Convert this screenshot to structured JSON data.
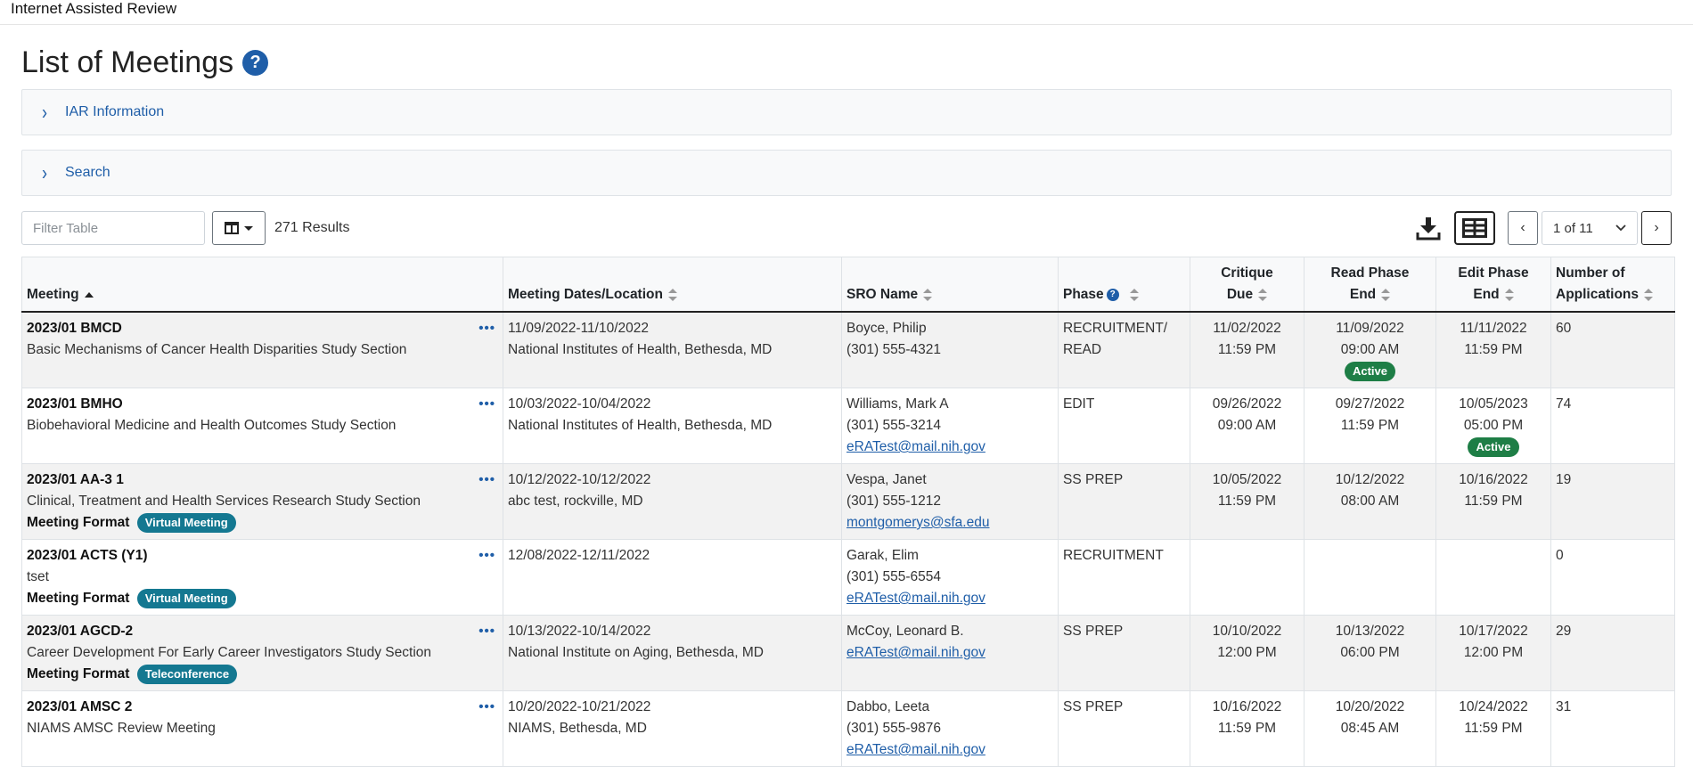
{
  "app": {
    "title": "Internet Assisted Review"
  },
  "page": {
    "title": "List of Meetings"
  },
  "accordions": {
    "iar_info": "IAR Information",
    "search": "Search"
  },
  "toolbar": {
    "filter_placeholder": "Filter Table",
    "results": "271 Results",
    "pagination": "1 of 11"
  },
  "table": {
    "headers": {
      "meeting": "Meeting",
      "dates": "Meeting Dates/Location",
      "sro": "SRO Name",
      "phase": "Phase",
      "critique_1": "Critique",
      "critique_2": "Due",
      "read_1": "Read Phase",
      "read_2": "End",
      "edit_1": "Edit Phase",
      "edit_2": "End",
      "apps_1": "Number of",
      "apps_2": "Applications"
    },
    "format_label": "Meeting Format",
    "rows": [
      {
        "code": "2023/01 BMCD",
        "name": "Basic Mechanisms of Cancer Health Disparities Study Section",
        "format": "",
        "dates": "11/09/2022-11/10/2022",
        "location": "National Institutes of Health, Bethesda, MD",
        "sro_name": "Boyce, Philip",
        "sro_phone": "(301) 555-4321",
        "sro_email": "",
        "phase": "RECRUITMENT/ READ",
        "critique_date": "11/02/2022",
        "critique_time": "11:59 PM",
        "read_date": "11/09/2022",
        "read_time": "09:00 AM",
        "read_badge": "Active",
        "edit_date": "11/11/2022",
        "edit_time": "11:59 PM",
        "edit_badge": "",
        "apps": "60"
      },
      {
        "code": "2023/01 BMHO",
        "name": "Biobehavioral Medicine and Health Outcomes Study Section",
        "format": "",
        "dates": "10/03/2022-10/04/2022",
        "location": "National Institutes of Health, Bethesda, MD",
        "sro_name": "Williams, Mark A",
        "sro_phone": "(301) 555-3214",
        "sro_email": "eRATest@mail.nih.gov",
        "phase": "EDIT",
        "critique_date": "09/26/2022",
        "critique_time": "09:00 AM",
        "read_date": "09/27/2022",
        "read_time": "11:59 PM",
        "read_badge": "",
        "edit_date": "10/05/2023",
        "edit_time": "05:00 PM",
        "edit_badge": "Active",
        "apps": "74"
      },
      {
        "code": "2023/01 AA-3 1",
        "name": "Clinical, Treatment and Health Services Research Study Section",
        "format": "Virtual Meeting",
        "dates": "10/12/2022-10/12/2022",
        "location": "abc test, rockville, MD",
        "sro_name": "Vespa, Janet",
        "sro_phone": "(301) 555-1212",
        "sro_email": "montgomerys@sfa.edu",
        "phase": "SS PREP",
        "critique_date": "10/05/2022",
        "critique_time": "11:59 PM",
        "read_date": "10/12/2022",
        "read_time": "08:00 AM",
        "read_badge": "",
        "edit_date": "10/16/2022",
        "edit_time": "11:59 PM",
        "edit_badge": "",
        "apps": "19"
      },
      {
        "code": "2023/01 ACTS (Y1)",
        "name": "tset",
        "format": "Virtual Meeting",
        "dates": "12/08/2022-12/11/2022",
        "location": "",
        "sro_name": "Garak, Elim",
        "sro_phone": "(301) 555-6554",
        "sro_email": "eRATest@mail.nih.gov",
        "phase": "RECRUITMENT",
        "critique_date": "",
        "critique_time": "",
        "read_date": "",
        "read_time": "",
        "read_badge": "",
        "edit_date": "",
        "edit_time": "",
        "edit_badge": "",
        "apps": "0"
      },
      {
        "code": "2023/01 AGCD-2",
        "name": "Career Development For Early Career Investigators Study Section",
        "format": "Teleconference",
        "dates": "10/13/2022-10/14/2022",
        "location": "National Institute on Aging, Bethesda, MD",
        "sro_name": "McCoy, Leonard B.",
        "sro_phone": "",
        "sro_email": "eRATest@mail.nih.gov",
        "phase": "SS PREP",
        "critique_date": "10/10/2022",
        "critique_time": "12:00 PM",
        "read_date": "10/13/2022",
        "read_time": "06:00 PM",
        "read_badge": "",
        "edit_date": "10/17/2022",
        "edit_time": "12:00 PM",
        "edit_badge": "",
        "apps": "29"
      },
      {
        "code": "2023/01 AMSC 2",
        "name": "NIAMS AMSC Review Meeting",
        "format": "",
        "dates": "10/20/2022-10/21/2022",
        "location": "NIAMS, Bethesda, MD",
        "sro_name": "Dabbo, Leeta",
        "sro_phone": "(301) 555-9876",
        "sro_email": "eRATest@mail.nih.gov",
        "phase": "SS PREP",
        "critique_date": "10/16/2022",
        "critique_time": "11:59 PM",
        "read_date": "10/20/2022",
        "read_time": "08:45 AM",
        "read_badge": "",
        "edit_date": "10/24/2022",
        "edit_time": "11:59 PM",
        "edit_badge": "",
        "apps": "31"
      }
    ]
  }
}
